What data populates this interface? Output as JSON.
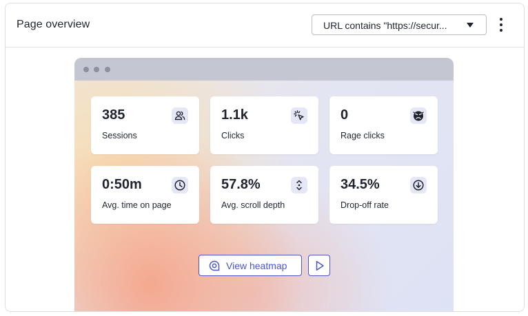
{
  "header": {
    "title": "Page overview",
    "url_filter": {
      "selected": "URL contains \"https://secur..."
    }
  },
  "stats": [
    {
      "value": "385",
      "label": "Sessions",
      "icon": "users-icon"
    },
    {
      "value": "1.1k",
      "label": "Clicks",
      "icon": "cursor-click-icon"
    },
    {
      "value": "0",
      "label": "Rage clicks",
      "icon": "angry-face-icon"
    },
    {
      "value": "0:50m",
      "label": "Avg. time on page",
      "icon": "clock-icon"
    },
    {
      "value": "57.8%",
      "label": "Avg. scroll depth",
      "icon": "scroll-arrows-icon"
    },
    {
      "value": "34.5%",
      "label": "Drop-off rate",
      "icon": "arrow-down-circle-icon"
    }
  ],
  "actions": {
    "view_heatmap_label": "View heatmap",
    "heatmap_icon": "heatmap-icon",
    "play_icon": "play-icon"
  },
  "colors": {
    "accent": "#4c55c9",
    "icon_bg": "#e6e7f6",
    "browser_bar": "#c4c6d2"
  }
}
